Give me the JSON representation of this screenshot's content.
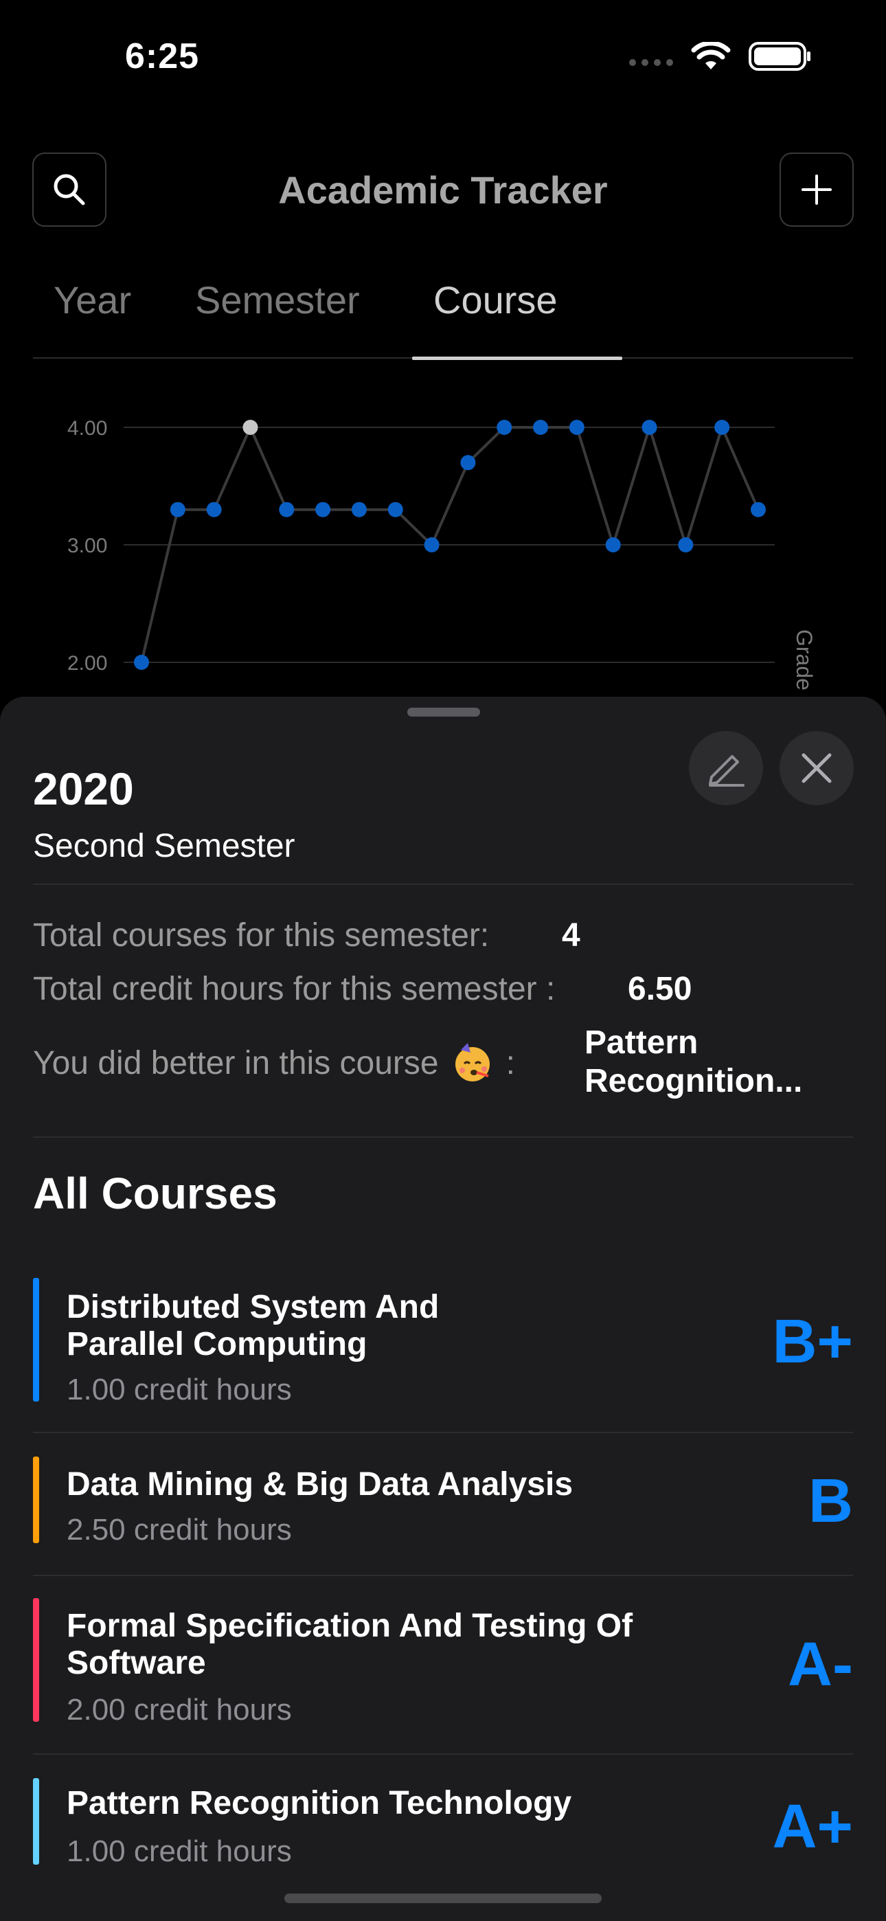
{
  "status": {
    "time": "6:25"
  },
  "nav": {
    "title": "Academic Tracker",
    "search_icon": "search-icon",
    "add_icon": "plus-icon"
  },
  "tabs": [
    {
      "label": "Year",
      "active": false
    },
    {
      "label": "Semester",
      "active": false
    },
    {
      "label": "Course",
      "active": true
    }
  ],
  "chart_data": {
    "type": "line",
    "ylabel": "Grade",
    "y_ticks": [
      "4.00",
      "3.00",
      "2.00"
    ],
    "ylim": [
      1.7,
      4.1
    ],
    "values": [
      2.0,
      3.3,
      3.3,
      4.0,
      3.3,
      3.3,
      3.3,
      3.3,
      3.0,
      3.7,
      4.0,
      4.0,
      4.0,
      3.0,
      4.0,
      3.0,
      4.0,
      3.3
    ],
    "highlighted_index": 3,
    "colors": {
      "point": "#0a5fc4",
      "highlight": "#c7c7c7",
      "line": "#3a3a3c",
      "grid": "#2c2c2e"
    }
  },
  "sheet": {
    "year": "2020",
    "semester": "Second Semester",
    "stats": {
      "courses_label": "Total courses for this semester:",
      "courses_value": "4",
      "credits_label": "Total credit hours for this semester :",
      "credits_value": "6.50",
      "best_label": "You did better in this course",
      "best_suffix": ":",
      "best_value_line1": "Pattern",
      "best_value_line2": "Recognition..."
    },
    "section_title": "All Courses",
    "courses": [
      {
        "name": "Distributed System And Parallel Computing",
        "hours": "1.00 credit hours",
        "grade": "B+",
        "color": "#0a84ff"
      },
      {
        "name": "Data Mining & Big Data Analysis",
        "hours": "2.50 credit hours",
        "grade": "B",
        "color": "#ff9f0a"
      },
      {
        "name": "Formal Specification And Testing Of Software",
        "hours": "2.00 credit hours",
        "grade": "A-",
        "color": "#ff375f"
      },
      {
        "name": "Pattern Recognition Technology",
        "hours": "1.00 credit hours",
        "grade": "A+",
        "color": "#64d2ff"
      }
    ]
  }
}
